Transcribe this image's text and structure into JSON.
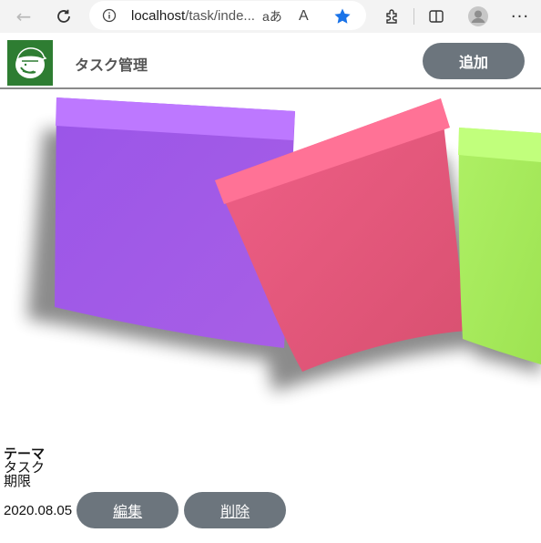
{
  "browser": {
    "url_host": "localhost",
    "url_path": "/task/inde...",
    "read_aloud_label": "aあ",
    "reader_label": "A",
    "star_color": "#1a73e8"
  },
  "header": {
    "title": "タスク管理",
    "add_label": "追加",
    "logo_color": "#2e7d32"
  },
  "card": {
    "theme_label": "テーマ",
    "task_label": "タスク",
    "deadline_label": "期限",
    "date": "2020.08.05",
    "edit_label": "編集",
    "delete_label": "削除",
    "note_colors": [
      "#a05ae6",
      "#e85a7c",
      "#a6ee5a"
    ]
  }
}
